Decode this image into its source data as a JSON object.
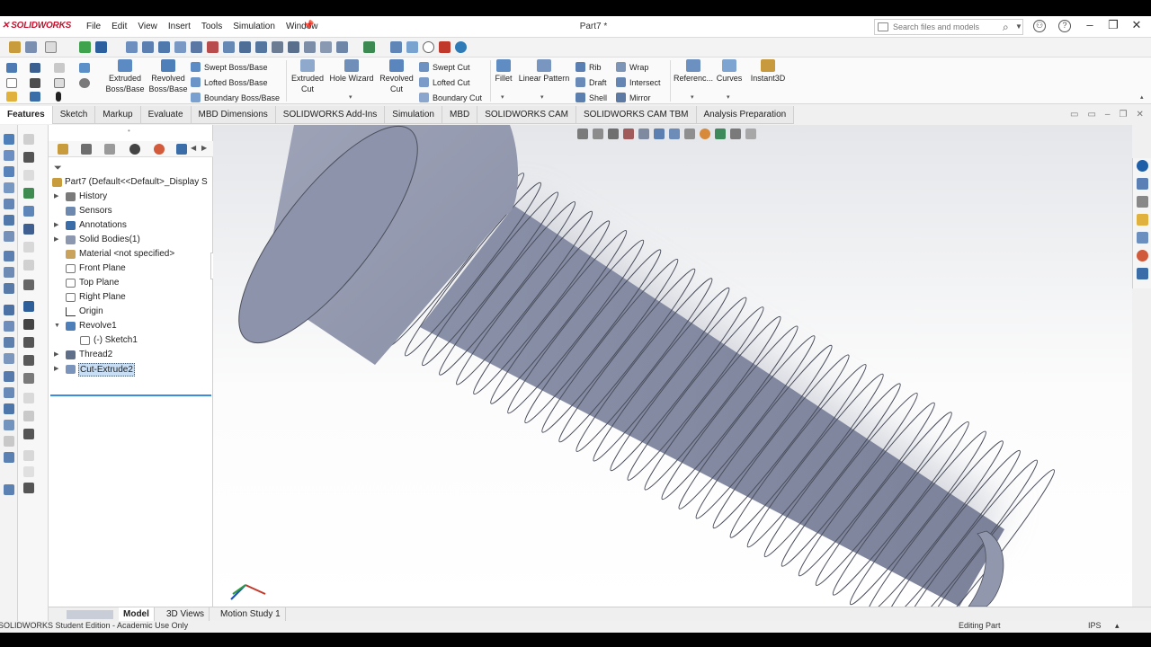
{
  "app": {
    "logo": "SOLIDWORKS",
    "document_title": "Part7 *",
    "menu": [
      "File",
      "Edit",
      "View",
      "Insert",
      "Tools",
      "Simulation",
      "Window"
    ]
  },
  "search": {
    "placeholder": "Search files and models"
  },
  "command_manager": {
    "extruded_boss": "Extruded\nBoss/Base",
    "revolved_boss": "Revolved\nBoss/Base",
    "swept_boss": "Swept Boss/Base",
    "lofted_boss": "Lofted Boss/Base",
    "boundary_boss": "Boundary Boss/Base",
    "extruded_cut": "Extruded\nCut",
    "hole_wizard": "Hole Wizard",
    "revolved_cut": "Revolved\nCut",
    "swept_cut": "Swept Cut",
    "lofted_cut": "Lofted Cut",
    "boundary_cut": "Boundary Cut",
    "fillet": "Fillet",
    "linear_pattern": "Linear Pattern",
    "rib": "Rib",
    "draft": "Draft",
    "shell": "Shell",
    "wrap": "Wrap",
    "intersect": "Intersect",
    "mirror": "Mirror",
    "reference": "Referenc...",
    "curves": "Curves",
    "instant3d": "Instant3D"
  },
  "tabs": [
    "Features",
    "Sketch",
    "Markup",
    "Evaluate",
    "MBD Dimensions",
    "SOLIDWORKS Add-Ins",
    "Simulation",
    "MBD",
    "SOLIDWORKS CAM",
    "SOLIDWORKS CAM TBM",
    "Analysis Preparation"
  ],
  "feature_tree": {
    "root": "Part7  (Default<<Default>_Display S",
    "history": "History",
    "sensors": "Sensors",
    "annotations": "Annotations",
    "solid_bodies": "Solid Bodies(1)",
    "material": "Material <not specified>",
    "front_plane": "Front Plane",
    "top_plane": "Top Plane",
    "right_plane": "Right Plane",
    "origin": "Origin",
    "revolve1": "Revolve1",
    "sketch1": "(-) Sketch1",
    "thread2": "Thread2",
    "cut_extrude2": "Cut-Extrude2"
  },
  "bottom_tabs": [
    "Model",
    "3D Views",
    "Motion Study 1"
  ],
  "status": {
    "left": "SOLIDWORKS Student Edition - Academic Use Only",
    "mode": "Editing Part",
    "units": "IPS"
  },
  "colors": {
    "part_body": "#8a90a6",
    "accent": "#3a8dde",
    "brand": "#c8102e"
  }
}
